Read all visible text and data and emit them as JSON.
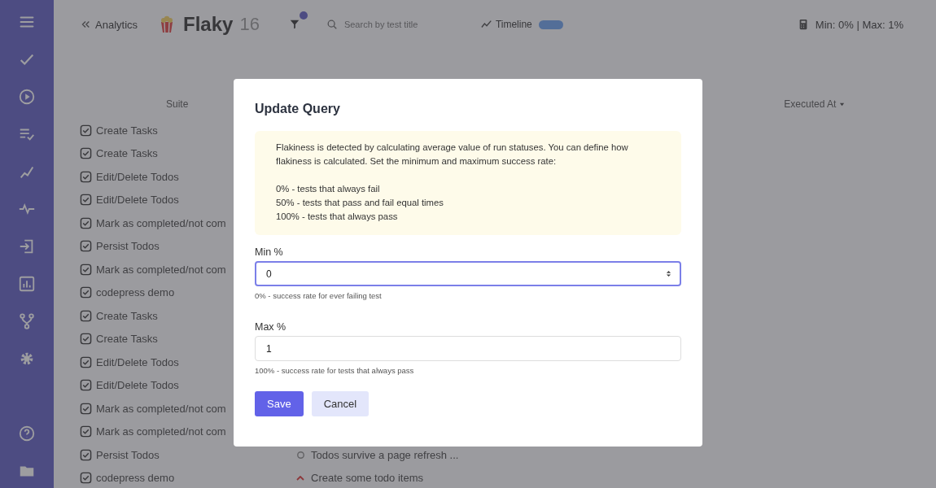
{
  "header": {
    "back_link": "Analytics",
    "title": "Flaky",
    "count": "16",
    "search": {
      "placeholder": "Search by test title"
    },
    "timeline": "Timeline",
    "range": "Min: 0% | Max: 1%"
  },
  "table": {
    "columns": [
      "Suite",
      "Executed At"
    ],
    "rows": [
      {
        "suite": "Create Tasks"
      },
      {
        "suite": "Create Tasks"
      },
      {
        "suite": "Edit/Delete Todos"
      },
      {
        "suite": "Edit/Delete Todos"
      },
      {
        "suite": "Mark as completed/not com"
      },
      {
        "suite": "Persist Todos"
      },
      {
        "suite": "Mark as completed/not com"
      },
      {
        "suite": "codepress demo"
      },
      {
        "suite": "Create Tasks"
      },
      {
        "suite": "Create Tasks"
      },
      {
        "suite": "Edit/Delete Todos"
      },
      {
        "suite": "Edit/Delete Todos"
      },
      {
        "suite": "Mark as completed/not com"
      },
      {
        "suite": "Mark as completed/not com"
      },
      {
        "suite": "Persist Todos",
        "test": {
          "title": "Todos survive a page refresh ...",
          "kind": "circle"
        }
      },
      {
        "suite": "codepress demo",
        "test": {
          "title": "Create some todo items",
          "kind": "caret"
        }
      }
    ]
  },
  "dialog": {
    "title": "Update Query",
    "info": [
      "Flakiness is detected by calculating average value of run statuses. You can define how flakiness is calculated. Set the minimum and maximum success rate:",
      "0% - tests that always fail",
      "50% - tests that pass and fail equal times",
      "100% - tests that always pass"
    ],
    "fields": [
      {
        "label": "Min %",
        "value": "0",
        "hint": "0% - success rate for ever failing test",
        "focused": true
      },
      {
        "label": "Max %",
        "value": "1",
        "hint": "100% - success rate for tests that always pass",
        "focused": false
      }
    ],
    "buttons": [
      {
        "label": "Save",
        "kind": "primary"
      },
      {
        "label": "Cancel",
        "kind": "secondary"
      }
    ]
  }
}
